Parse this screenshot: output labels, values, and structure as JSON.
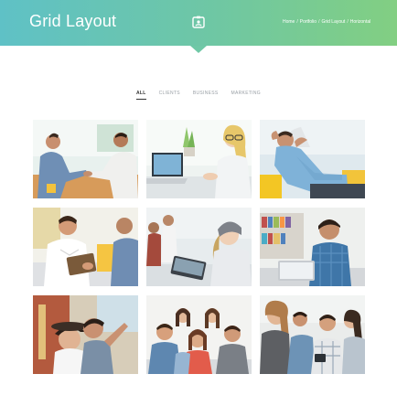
{
  "header": {
    "title": "Grid Layout",
    "icon": "id-card-icon",
    "breadcrumb": [
      "Home",
      "Portfolio",
      "Grid Layout",
      "Horizontal"
    ],
    "breadcrumb_separator": "/"
  },
  "filters": [
    {
      "label": "ALL",
      "active": true
    },
    {
      "label": "CLIENTS",
      "active": false
    },
    {
      "label": "BUSINESS",
      "active": false
    },
    {
      "label": "MARKETING",
      "active": false
    }
  ],
  "gallery": {
    "items": [
      {
        "subject": "handshake-photo"
      },
      {
        "subject": "woman-at-laptop-photo"
      },
      {
        "subject": "relaxed-man-photo"
      },
      {
        "subject": "man-with-tablet-photo"
      },
      {
        "subject": "office-team-photo"
      },
      {
        "subject": "man-on-laptop-photo"
      },
      {
        "subject": "couple-selfie-photo"
      },
      {
        "subject": "group-friends-photo"
      },
      {
        "subject": "friends-with-phone-photo"
      }
    ]
  },
  "colors": {
    "header_start": "#5fc1c6",
    "header_end": "#82cf82",
    "active_filter": "#333333",
    "inactive_filter": "#9aa0a6"
  }
}
